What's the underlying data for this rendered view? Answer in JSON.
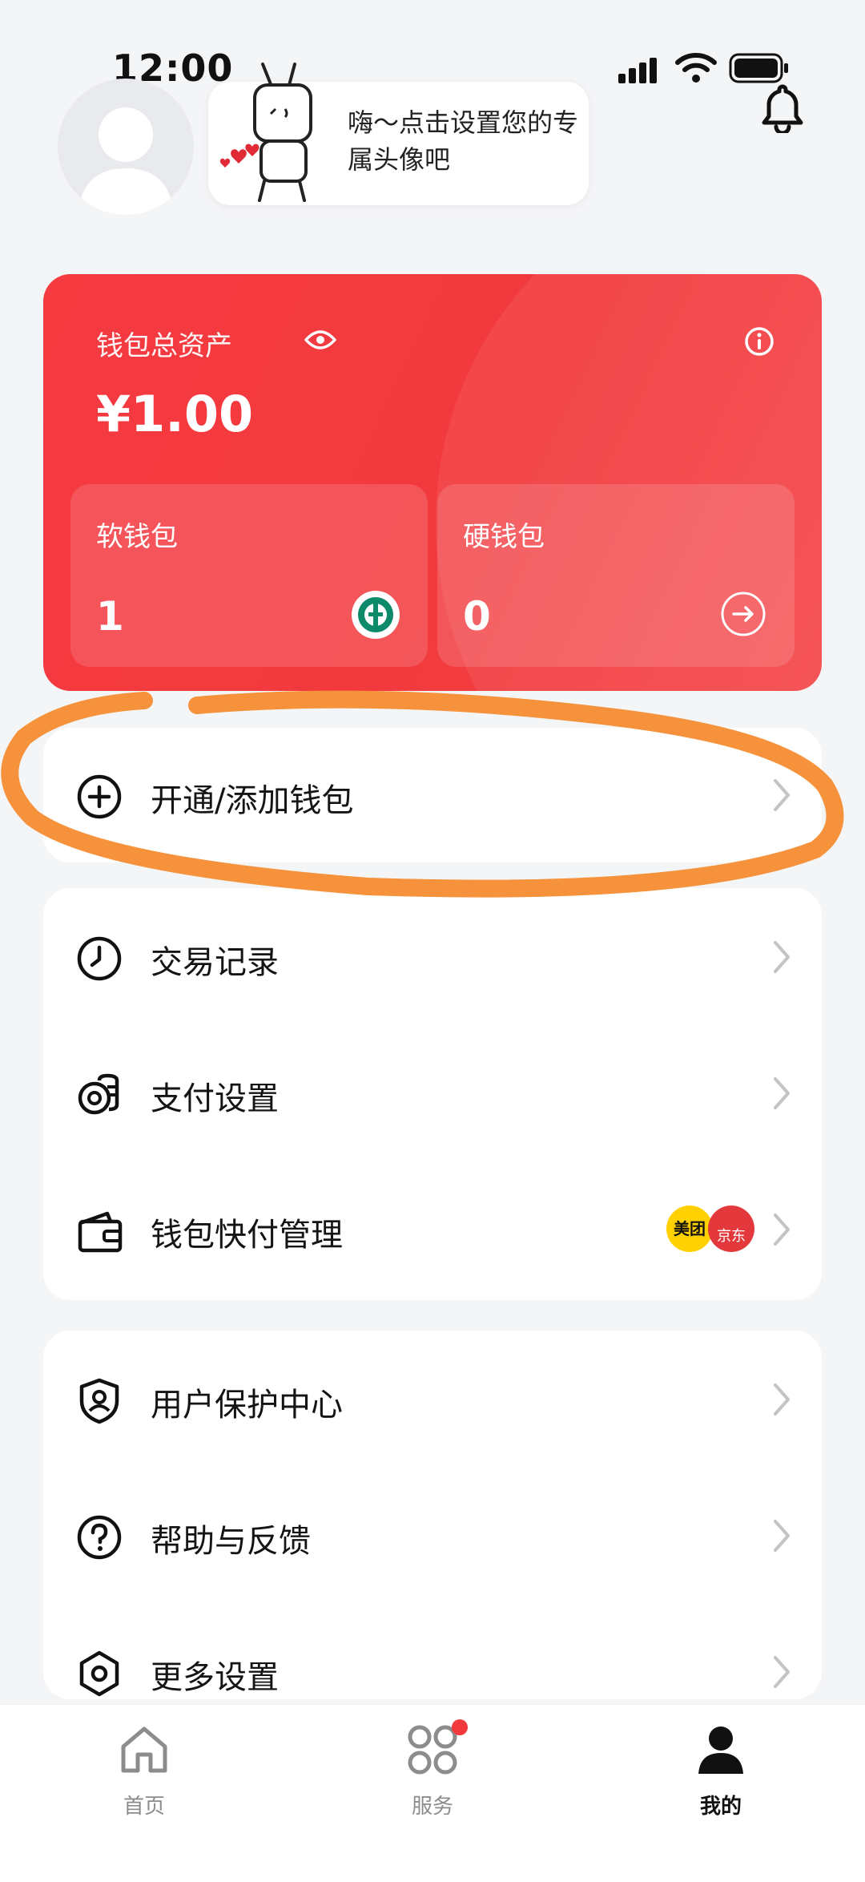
{
  "status_bar": {
    "time": "12:00"
  },
  "profile": {
    "bubble_text": "嗨～点击设置您的专属头像吧"
  },
  "wallet": {
    "total_label": "钱包总资产",
    "total_amount": "¥1.00",
    "soft_wallet": {
      "label": "软钱包",
      "value": "1"
    },
    "hard_wallet": {
      "label": "硬钱包",
      "value": "0"
    },
    "accent_color": "#f23a3e"
  },
  "menu": {
    "open_wallet": "开通/添加钱包",
    "group_a": [
      {
        "label": "交易记录",
        "icon": "clock-icon"
      },
      {
        "label": "支付设置",
        "icon": "coins-icon"
      },
      {
        "label": "钱包快付管理",
        "icon": "wallet-icon",
        "badges": [
          "美团",
          "京东"
        ]
      }
    ],
    "group_b": [
      {
        "label": "用户保护中心",
        "icon": "shield-user-icon"
      },
      {
        "label": "帮助与反馈",
        "icon": "question-icon"
      },
      {
        "label": "更多设置",
        "icon": "hex-gear-icon"
      }
    ]
  },
  "tab_bar": {
    "tabs": [
      {
        "label": "首页",
        "icon": "home-icon"
      },
      {
        "label": "服务",
        "icon": "grid-icon",
        "has_dot": true
      },
      {
        "label": "我的",
        "icon": "person-icon",
        "active": true
      }
    ]
  },
  "annotation_color": "#f5923b"
}
